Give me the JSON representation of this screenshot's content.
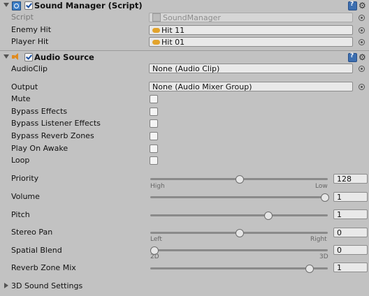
{
  "sound_manager": {
    "title": "Sound Manager (Script)",
    "enabled": true,
    "script_label": "Script",
    "script_value": "SoundManager",
    "enemy_hit_label": "Enemy Hit",
    "enemy_hit_value": "Hit 11",
    "player_hit_label": "Player Hit",
    "player_hit_value": "Hit 01"
  },
  "audio_source": {
    "title": "Audio Source",
    "enabled": true,
    "audio_clip_label": "AudioClip",
    "audio_clip_value": "None (Audio Clip)",
    "output_label": "Output",
    "output_value": "None (Audio Mixer Group)",
    "toggles": [
      {
        "label": "Mute",
        "checked": false
      },
      {
        "label": "Bypass Effects",
        "checked": false
      },
      {
        "label": "Bypass Listener Effects",
        "checked": false
      },
      {
        "label": "Bypass Reverb Zones",
        "checked": false
      },
      {
        "label": "Play On Awake",
        "checked": false
      },
      {
        "label": "Loop",
        "checked": false
      }
    ],
    "priority": {
      "label": "Priority",
      "value": "128",
      "level": 0.5,
      "min_caption": "High",
      "max_caption": "Low"
    },
    "volume": {
      "label": "Volume",
      "value": "1",
      "level": 1.0
    },
    "pitch": {
      "label": "Pitch",
      "value": "1",
      "level": 0.667
    },
    "stereo_pan": {
      "label": "Stereo Pan",
      "value": "0",
      "level": 0.5,
      "min_caption": "Left",
      "max_caption": "Right"
    },
    "spatial_blend": {
      "label": "Spatial Blend",
      "value": "0",
      "level": 0.0,
      "min_caption": "2D",
      "max_caption": "3D"
    },
    "reverb_zone_mix": {
      "label": "Reverb Zone Mix",
      "value": "1",
      "level": 0.909
    },
    "sound_settings_label": "3D Sound Settings"
  },
  "icons": {
    "script": "script-icon",
    "audio": "speaker-icon",
    "help": "help-icon",
    "settings": "gear-icon",
    "object_picker": "object-picker-icon"
  }
}
